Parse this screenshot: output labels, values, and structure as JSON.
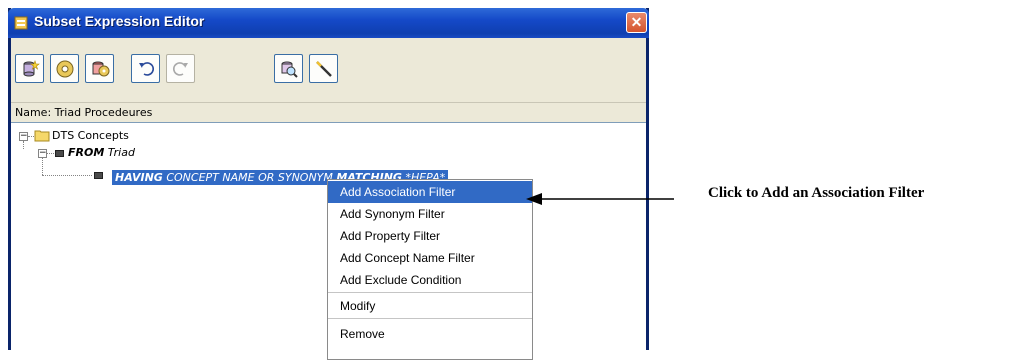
{
  "window": {
    "title": "Subset Expression Editor",
    "close_glyph": "✕"
  },
  "toolbar": {
    "buttons": [
      {
        "name": "new-concept-icon"
      },
      {
        "name": "cd-icon"
      },
      {
        "name": "multi-disc-icon"
      },
      {
        "name": "undo-icon"
      },
      {
        "name": "redo-icon",
        "disabled": true
      },
      {
        "name": "search-icon"
      },
      {
        "name": "wand-icon"
      }
    ]
  },
  "name_field": {
    "label": "Name: Triad Procedeures"
  },
  "tree": {
    "root": "DTS Concepts",
    "from_kw": "FROM",
    "from_val": "Triad",
    "having_kw": "HAVING",
    "having_mid": "CONCEPT NAME OR SYNONYM",
    "matching_kw": "MATCHING",
    "matching_val": "*HEPA*"
  },
  "context_menu": {
    "items": [
      "Add Association Filter",
      "Add Synonym Filter",
      "Add Property Filter",
      "Add Concept Name Filter",
      "Add Exclude Condition",
      "Modify",
      "Remove"
    ]
  },
  "annotation": {
    "text": "Click to Add an Association Filter"
  },
  "colors": {
    "selection": "#316ac5",
    "titlebar": "#1549c8"
  }
}
